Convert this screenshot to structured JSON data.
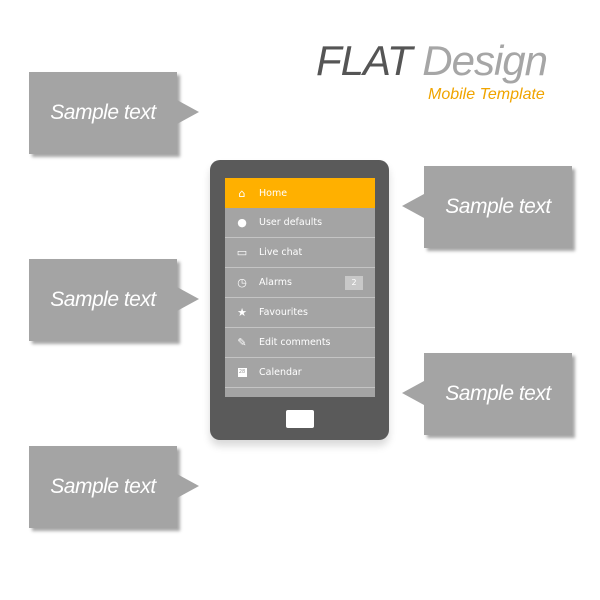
{
  "header": {
    "title_part1": "FLAT",
    "title_part2": "Design",
    "subtitle": "Mobile Template"
  },
  "callouts": [
    {
      "text": "Sample text",
      "side": "left"
    },
    {
      "text": "Sample text",
      "side": "left"
    },
    {
      "text": "Sample text",
      "side": "left"
    },
    {
      "text": "Sample text",
      "side": "right"
    },
    {
      "text": "Sample text",
      "side": "right"
    }
  ],
  "colors": {
    "accent": "#ffb000",
    "phone_body": "#5a5a5a",
    "box": "#a4a4a4"
  },
  "menu": {
    "items": [
      {
        "label": "Home",
        "icon": "home-icon",
        "glyph": "⌂",
        "active": true
      },
      {
        "label": "User defaults",
        "icon": "user-icon",
        "glyph": "👤"
      },
      {
        "label": "Live chat",
        "icon": "chat-icon",
        "glyph": "▭"
      },
      {
        "label": "Alarms",
        "icon": "clock-icon",
        "glyph": "◷",
        "badge": "2"
      },
      {
        "label": "Favourites",
        "icon": "star-icon",
        "glyph": "★"
      },
      {
        "label": "Edit comments",
        "icon": "pencil-icon",
        "glyph": "✎"
      },
      {
        "label": "Calendar",
        "icon": "calendar-icon",
        "glyph": "28"
      }
    ]
  }
}
